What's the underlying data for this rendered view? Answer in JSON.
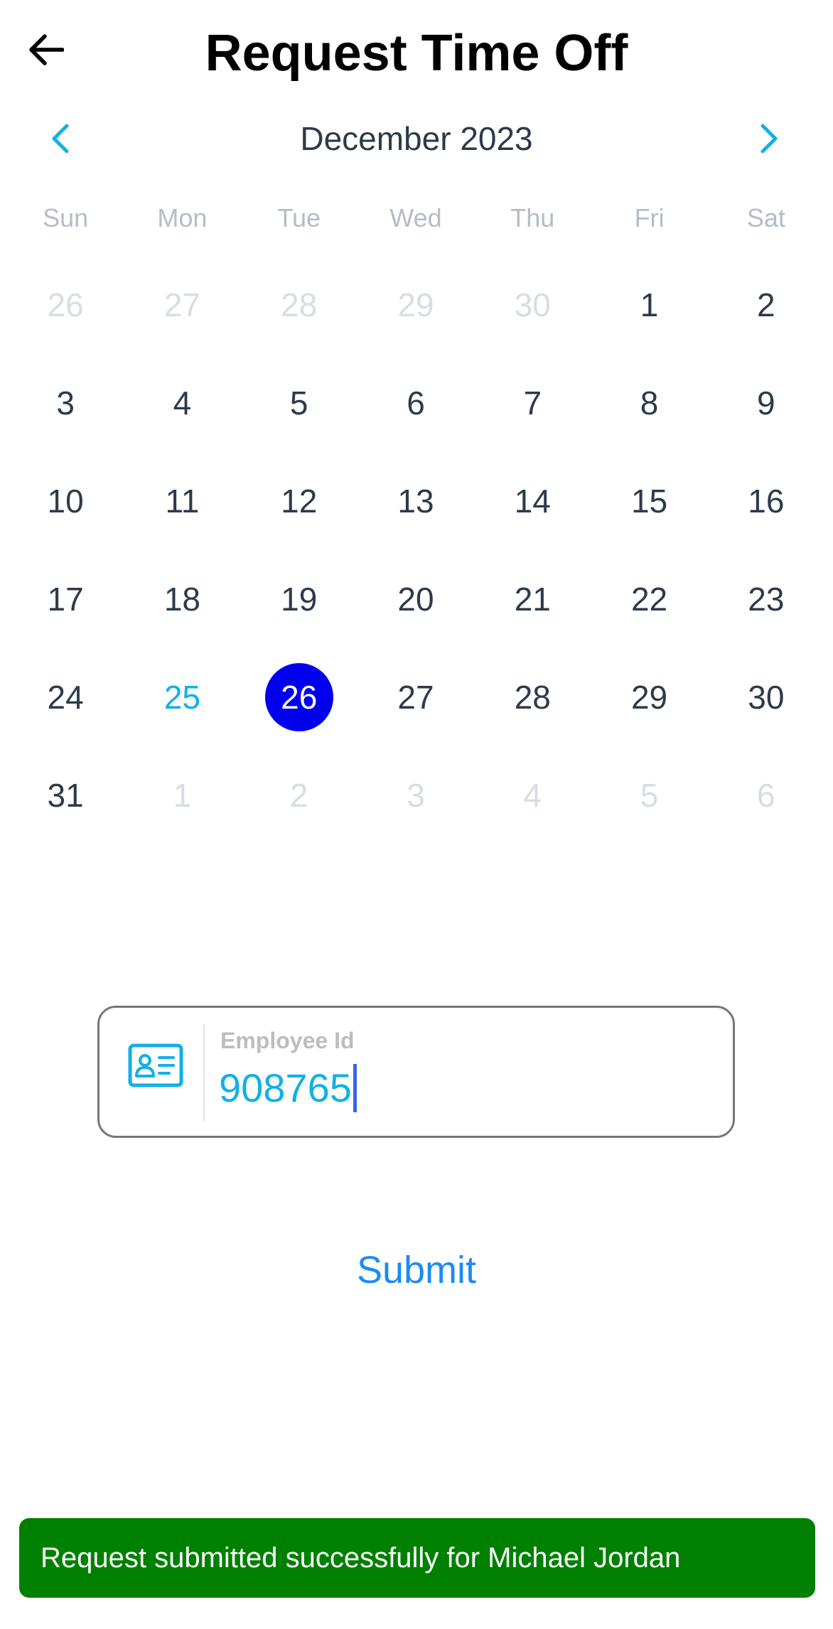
{
  "header": {
    "title": "Request Time Off",
    "back_icon": "arrow-left-icon"
  },
  "calendar": {
    "month_label": "December 2023",
    "prev_icon": "chevron-left-icon",
    "next_icon": "chevron-right-icon",
    "accent_color": "#12b0e6",
    "selected_color": "#0000ee",
    "weekdays": [
      "Sun",
      "Mon",
      "Tue",
      "Wed",
      "Thu",
      "Fri",
      "Sat"
    ],
    "days": [
      {
        "label": "26",
        "state": "other"
      },
      {
        "label": "27",
        "state": "other"
      },
      {
        "label": "28",
        "state": "other"
      },
      {
        "label": "29",
        "state": "other"
      },
      {
        "label": "30",
        "state": "other"
      },
      {
        "label": "1",
        "state": "current"
      },
      {
        "label": "2",
        "state": "current"
      },
      {
        "label": "3",
        "state": "current"
      },
      {
        "label": "4",
        "state": "current"
      },
      {
        "label": "5",
        "state": "current"
      },
      {
        "label": "6",
        "state": "current"
      },
      {
        "label": "7",
        "state": "current"
      },
      {
        "label": "8",
        "state": "current"
      },
      {
        "label": "9",
        "state": "current"
      },
      {
        "label": "10",
        "state": "current"
      },
      {
        "label": "11",
        "state": "current"
      },
      {
        "label": "12",
        "state": "current"
      },
      {
        "label": "13",
        "state": "current"
      },
      {
        "label": "14",
        "state": "current"
      },
      {
        "label": "15",
        "state": "current"
      },
      {
        "label": "16",
        "state": "current"
      },
      {
        "label": "17",
        "state": "current"
      },
      {
        "label": "18",
        "state": "current"
      },
      {
        "label": "19",
        "state": "current"
      },
      {
        "label": "20",
        "state": "current"
      },
      {
        "label": "21",
        "state": "current"
      },
      {
        "label": "22",
        "state": "current"
      },
      {
        "label": "23",
        "state": "current"
      },
      {
        "label": "24",
        "state": "current"
      },
      {
        "label": "25",
        "state": "today"
      },
      {
        "label": "26",
        "state": "selected"
      },
      {
        "label": "27",
        "state": "current"
      },
      {
        "label": "28",
        "state": "current"
      },
      {
        "label": "29",
        "state": "current"
      },
      {
        "label": "30",
        "state": "current"
      },
      {
        "label": "31",
        "state": "current"
      },
      {
        "label": "1",
        "state": "other"
      },
      {
        "label": "2",
        "state": "other"
      },
      {
        "label": "3",
        "state": "other"
      },
      {
        "label": "4",
        "state": "other"
      },
      {
        "label": "5",
        "state": "other"
      },
      {
        "label": "6",
        "state": "other"
      }
    ]
  },
  "employee_field": {
    "icon": "id-card-icon",
    "label": "Employee Id",
    "value": "908765"
  },
  "actions": {
    "submit_label": "Submit",
    "link_color": "#1a8cf0"
  },
  "toast": {
    "message": "Request submitted successfully for Michael Jordan",
    "color": "#008000"
  }
}
